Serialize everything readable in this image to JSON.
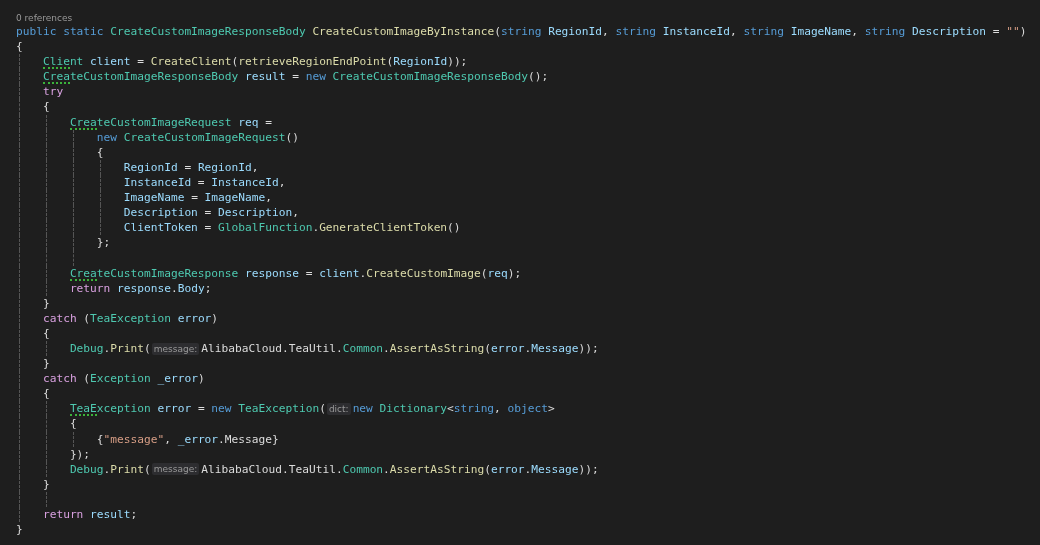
{
  "codelens": "0 references",
  "lines": [
    {
      "kind": "code",
      "tokens": [
        {
          "kind": "kw",
          "text": "public static "
        },
        {
          "kind": "type",
          "text": "CreateCustomImageResponseBody "
        },
        {
          "kind": "method",
          "text": "CreateCustomImageByInstance"
        },
        {
          "kind": "plain",
          "text": "("
        },
        {
          "kind": "kw",
          "text": "string "
        },
        {
          "kind": "var",
          "text": "RegionId"
        },
        {
          "kind": "plain",
          "text": ", "
        },
        {
          "kind": "kw",
          "text": "string "
        },
        {
          "kind": "var",
          "text": "InstanceId"
        },
        {
          "kind": "plain",
          "text": ", "
        },
        {
          "kind": "kw",
          "text": "string "
        },
        {
          "kind": "var",
          "text": "ImageName"
        },
        {
          "kind": "plain",
          "text": ", "
        },
        {
          "kind": "kw",
          "text": "string "
        },
        {
          "kind": "var",
          "text": "Description"
        },
        {
          "kind": "plain",
          "text": " = "
        },
        {
          "kind": "str",
          "text": "\"\""
        },
        {
          "kind": "plain",
          "text": ")"
        }
      ]
    },
    {
      "kind": "code",
      "tokens": [
        {
          "kind": "plain",
          "text": "{"
        }
      ]
    },
    {
      "kind": "code",
      "tokens": [
        {
          "kind": "type",
          "text": "    Client ",
          "dots": true
        },
        {
          "kind": "var",
          "text": "client"
        },
        {
          "kind": "plain",
          "text": " = "
        },
        {
          "kind": "method",
          "text": "CreateClient"
        },
        {
          "kind": "plain",
          "text": "("
        },
        {
          "kind": "method",
          "text": "retrieveRegionEndPoint"
        },
        {
          "kind": "plain",
          "text": "("
        },
        {
          "kind": "var",
          "text": "RegionId"
        },
        {
          "kind": "plain",
          "text": "));"
        }
      ]
    },
    {
      "kind": "code",
      "tokens": [
        {
          "kind": "type",
          "text": "    CreateCustomImageResponseBody ",
          "dots": true
        },
        {
          "kind": "var",
          "text": "result"
        },
        {
          "kind": "plain",
          "text": " = "
        },
        {
          "kind": "kw",
          "text": "new "
        },
        {
          "kind": "type",
          "text": "CreateCustomImageResponseBody"
        },
        {
          "kind": "plain",
          "text": "();"
        }
      ]
    },
    {
      "kind": "code",
      "tokens": [
        {
          "kind": "ctl",
          "text": "    try"
        }
      ]
    },
    {
      "kind": "code",
      "tokens": [
        {
          "kind": "plain",
          "text": "    {"
        }
      ]
    },
    {
      "kind": "code",
      "tokens": [
        {
          "kind": "type",
          "text": "        CreateCustomImageRequest ",
          "dots": true
        },
        {
          "kind": "var",
          "text": "req"
        },
        {
          "kind": "plain",
          "text": " ="
        }
      ]
    },
    {
      "kind": "code",
      "tokens": [
        {
          "kind": "kw",
          "text": "            new "
        },
        {
          "kind": "type",
          "text": "CreateCustomImageRequest"
        },
        {
          "kind": "plain",
          "text": "()"
        }
      ]
    },
    {
      "kind": "code",
      "tokens": [
        {
          "kind": "plain",
          "text": "            {"
        }
      ]
    },
    {
      "kind": "code",
      "tokens": [
        {
          "kind": "var",
          "text": "                RegionId"
        },
        {
          "kind": "plain",
          "text": " = "
        },
        {
          "kind": "var",
          "text": "RegionId"
        },
        {
          "kind": "plain",
          "text": ","
        }
      ]
    },
    {
      "kind": "code",
      "tokens": [
        {
          "kind": "var",
          "text": "                InstanceId"
        },
        {
          "kind": "plain",
          "text": " = "
        },
        {
          "kind": "var",
          "text": "InstanceId"
        },
        {
          "kind": "plain",
          "text": ","
        }
      ]
    },
    {
      "kind": "code",
      "tokens": [
        {
          "kind": "var",
          "text": "                ImageName"
        },
        {
          "kind": "plain",
          "text": " = "
        },
        {
          "kind": "var",
          "text": "ImageName"
        },
        {
          "kind": "plain",
          "text": ","
        }
      ]
    },
    {
      "kind": "code",
      "tokens": [
        {
          "kind": "var",
          "text": "                Description"
        },
        {
          "kind": "plain",
          "text": " = "
        },
        {
          "kind": "var",
          "text": "Description"
        },
        {
          "kind": "plain",
          "text": ","
        }
      ]
    },
    {
      "kind": "code",
      "tokens": [
        {
          "kind": "var",
          "text": "                ClientToken"
        },
        {
          "kind": "plain",
          "text": " = "
        },
        {
          "kind": "type",
          "text": "GlobalFunction"
        },
        {
          "kind": "plain",
          "text": "."
        },
        {
          "kind": "method",
          "text": "GenerateClientToken"
        },
        {
          "kind": "plain",
          "text": "()"
        }
      ]
    },
    {
      "kind": "code",
      "tokens": [
        {
          "kind": "plain",
          "text": "            };"
        }
      ]
    },
    {
      "kind": "blank"
    },
    {
      "kind": "code",
      "tokens": [
        {
          "kind": "type",
          "text": "        CreateCustomImageResponse ",
          "dots": true
        },
        {
          "kind": "var",
          "text": "response"
        },
        {
          "kind": "plain",
          "text": " = "
        },
        {
          "kind": "var",
          "text": "client"
        },
        {
          "kind": "plain",
          "text": "."
        },
        {
          "kind": "method",
          "text": "CreateCustomImage"
        },
        {
          "kind": "plain",
          "text": "("
        },
        {
          "kind": "var",
          "text": "req"
        },
        {
          "kind": "plain",
          "text": ");"
        }
      ]
    },
    {
      "kind": "code",
      "tokens": [
        {
          "kind": "ctl",
          "text": "        return "
        },
        {
          "kind": "var",
          "text": "response"
        },
        {
          "kind": "plain",
          "text": "."
        },
        {
          "kind": "var",
          "text": "Body"
        },
        {
          "kind": "plain",
          "text": ";"
        }
      ]
    },
    {
      "kind": "code",
      "tokens": [
        {
          "kind": "plain",
          "text": "    }"
        }
      ]
    },
    {
      "kind": "code",
      "tokens": [
        {
          "kind": "ctl",
          "text": "    catch"
        },
        {
          "kind": "plain",
          "text": " ("
        },
        {
          "kind": "type",
          "text": "TeaException "
        },
        {
          "kind": "var",
          "text": "error"
        },
        {
          "kind": "plain",
          "text": ")"
        }
      ]
    },
    {
      "kind": "code",
      "tokens": [
        {
          "kind": "plain",
          "text": "    {"
        }
      ]
    },
    {
      "kind": "code",
      "tokens": [
        {
          "kind": "type",
          "text": "        Debug"
        },
        {
          "kind": "plain",
          "text": "."
        },
        {
          "kind": "method",
          "text": "Print"
        },
        {
          "kind": "plain",
          "text": "("
        },
        {
          "kind": "hint",
          "text": "message:"
        },
        {
          "kind": "plain",
          "text": "AlibabaCloud.TeaUtil."
        },
        {
          "kind": "type",
          "text": "Common"
        },
        {
          "kind": "plain",
          "text": "."
        },
        {
          "kind": "method",
          "text": "AssertAsString"
        },
        {
          "kind": "plain",
          "text": "("
        },
        {
          "kind": "var",
          "text": "error"
        },
        {
          "kind": "plain",
          "text": "."
        },
        {
          "kind": "var",
          "text": "Message"
        },
        {
          "kind": "plain",
          "text": "));"
        }
      ]
    },
    {
      "kind": "code",
      "tokens": [
        {
          "kind": "plain",
          "text": "    }"
        }
      ]
    },
    {
      "kind": "code",
      "tokens": [
        {
          "kind": "ctl",
          "text": "    catch"
        },
        {
          "kind": "plain",
          "text": " ("
        },
        {
          "kind": "type",
          "text": "Exception "
        },
        {
          "kind": "var",
          "text": "_error"
        },
        {
          "kind": "plain",
          "text": ")"
        }
      ]
    },
    {
      "kind": "code",
      "tokens": [
        {
          "kind": "plain",
          "text": "    {"
        }
      ]
    },
    {
      "kind": "code",
      "tokens": [
        {
          "kind": "type",
          "text": "        TeaException ",
          "dots": true
        },
        {
          "kind": "var",
          "text": "error"
        },
        {
          "kind": "plain",
          "text": " = "
        },
        {
          "kind": "kw",
          "text": "new "
        },
        {
          "kind": "type",
          "text": "TeaException"
        },
        {
          "kind": "plain",
          "text": "("
        },
        {
          "kind": "hint",
          "text": "dict:"
        },
        {
          "kind": "kw",
          "text": "new "
        },
        {
          "kind": "type",
          "text": "Dictionary"
        },
        {
          "kind": "plain",
          "text": "<"
        },
        {
          "kind": "kw",
          "text": "string"
        },
        {
          "kind": "plain",
          "text": ", "
        },
        {
          "kind": "kw",
          "text": "object"
        },
        {
          "kind": "plain",
          "text": ">"
        }
      ]
    },
    {
      "kind": "code",
      "tokens": [
        {
          "kind": "plain",
          "text": "        {"
        }
      ]
    },
    {
      "kind": "code",
      "tokens": [
        {
          "kind": "plain",
          "text": "            {"
        },
        {
          "kind": "str",
          "text": "\"message\""
        },
        {
          "kind": "plain",
          "text": ", "
        },
        {
          "kind": "var",
          "text": "_error"
        },
        {
          "kind": "plain",
          "text": ".Message}"
        }
      ]
    },
    {
      "kind": "code",
      "tokens": [
        {
          "kind": "plain",
          "text": "        });"
        }
      ]
    },
    {
      "kind": "code",
      "tokens": [
        {
          "kind": "type",
          "text": "        Debug"
        },
        {
          "kind": "plain",
          "text": "."
        },
        {
          "kind": "method",
          "text": "Print"
        },
        {
          "kind": "plain",
          "text": "("
        },
        {
          "kind": "hint",
          "text": "message:"
        },
        {
          "kind": "plain",
          "text": "AlibabaCloud.TeaUtil."
        },
        {
          "kind": "type",
          "text": "Common"
        },
        {
          "kind": "plain",
          "text": "."
        },
        {
          "kind": "method",
          "text": "AssertAsString"
        },
        {
          "kind": "plain",
          "text": "("
        },
        {
          "kind": "var",
          "text": "error"
        },
        {
          "kind": "plain",
          "text": "."
        },
        {
          "kind": "var",
          "text": "Message"
        },
        {
          "kind": "plain",
          "text": "));"
        }
      ]
    },
    {
      "kind": "code",
      "tokens": [
        {
          "kind": "plain",
          "text": "    }"
        }
      ]
    },
    {
      "kind": "blank"
    },
    {
      "kind": "code",
      "tokens": [
        {
          "kind": "ctl",
          "text": "    return "
        },
        {
          "kind": "var",
          "text": "result"
        },
        {
          "kind": "plain",
          "text": ";"
        }
      ]
    },
    {
      "kind": "code",
      "tokens": [
        {
          "kind": "plain",
          "text": "}"
        }
      ]
    }
  ]
}
